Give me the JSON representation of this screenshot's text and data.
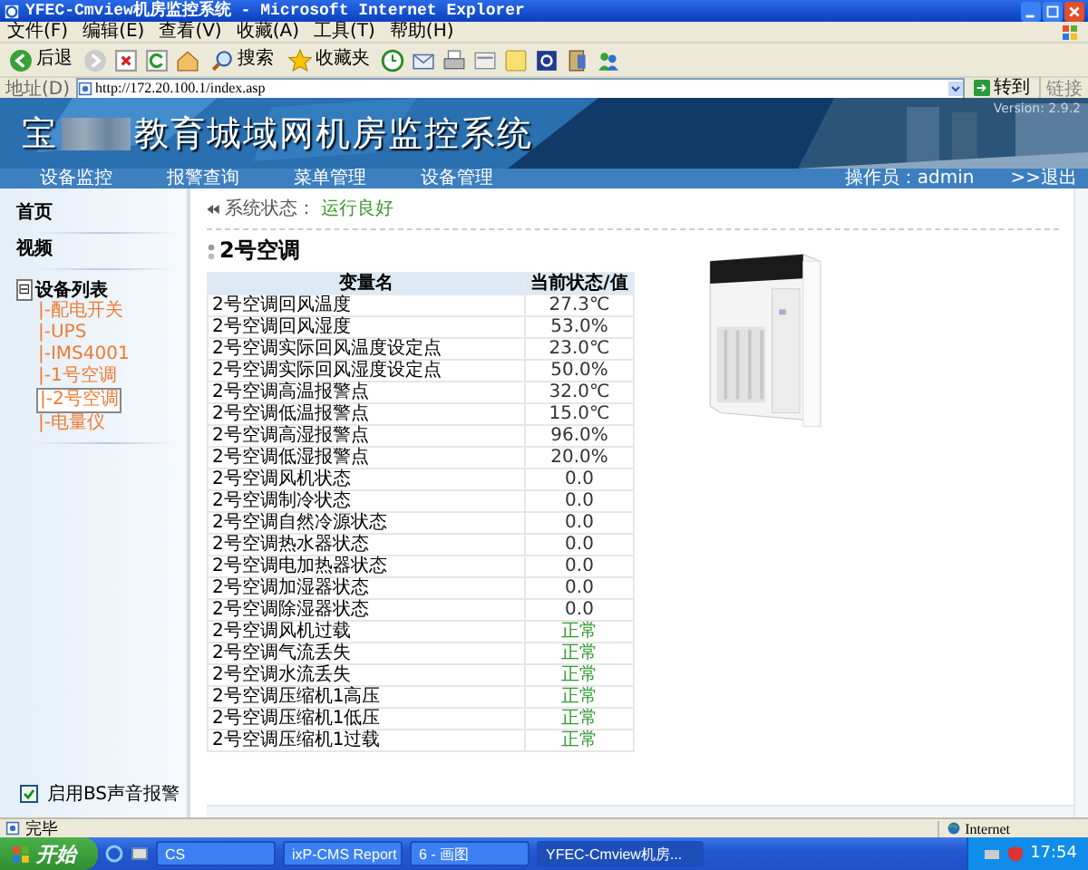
{
  "window": {
    "title": "YFEC-Cmview机房监控系统 - Microsoft Internet Explorer"
  },
  "menu": [
    "文件(F)",
    "编辑(E)",
    "查看(V)",
    "收藏(A)",
    "工具(T)",
    "帮助(H)"
  ],
  "toolbar": {
    "back": "后退",
    "search": "搜索",
    "favorites": "收藏夹"
  },
  "address": {
    "label": "地址(D)",
    "value": "http://172.20.100.1/index.asp",
    "go": "转到",
    "links": "链接"
  },
  "banner": {
    "title_start": "宝",
    "title_end": "教育城域网机房监控系统",
    "version": "Version: 2.9.2"
  },
  "nav": {
    "items": [
      {
        "label": "设备监控"
      },
      {
        "label": "报警查询"
      },
      {
        "label": "菜单管理"
      },
      {
        "label": "设备管理"
      }
    ],
    "operator": "操作员：admin",
    "logout": ">>退出"
  },
  "sidebar": {
    "items": [
      {
        "label": "首页"
      },
      {
        "label": "视频"
      }
    ],
    "tree": {
      "label": "设备列表",
      "expanded": true,
      "toggle": "⊟",
      "children": [
        {
          "label": "|-配电开关",
          "selected": false
        },
        {
          "label": "|-UPS",
          "selected": false
        },
        {
          "label": "|-IMS4001",
          "selected": false
        },
        {
          "label": "|-1号空调",
          "selected": false
        },
        {
          "label": "|-2号空调",
          "selected": true
        },
        {
          "label": "|-电量仪",
          "selected": false
        }
      ]
    },
    "sound_alarm": {
      "label": "启用BS声音报警",
      "checked": true
    }
  },
  "status_line": {
    "label": "系统状态：",
    "value": "运行良好"
  },
  "device_title": "2号空调",
  "table": {
    "columns": [
      "变量名",
      "当前状态/值"
    ],
    "rows": [
      {
        "name": "2号空调回风温度",
        "value": "27.3℃",
        "kind": "value"
      },
      {
        "name": "2号空调回风湿度",
        "value": "53.0%",
        "kind": "value"
      },
      {
        "name": "2号空调实际回风温度设定点",
        "value": "23.0℃",
        "kind": "value"
      },
      {
        "name": "2号空调实际回风湿度设定点",
        "value": "50.0%",
        "kind": "value"
      },
      {
        "name": "2号空调高温报警点",
        "value": "32.0℃",
        "kind": "value"
      },
      {
        "name": "2号空调低温报警点",
        "value": "15.0℃",
        "kind": "value"
      },
      {
        "name": "2号空调高湿报警点",
        "value": "96.0%",
        "kind": "value"
      },
      {
        "name": "2号空调低湿报警点",
        "value": "20.0%",
        "kind": "value"
      },
      {
        "name": "2号空调风机状态",
        "value": "0.0",
        "kind": "value"
      },
      {
        "name": "2号空调制冷状态",
        "value": "0.0",
        "kind": "value"
      },
      {
        "name": "2号空调自然冷源状态",
        "value": "0.0",
        "kind": "value"
      },
      {
        "name": "2号空调热水器状态",
        "value": "0.0",
        "kind": "value"
      },
      {
        "name": "2号空调电加热器状态",
        "value": "0.0",
        "kind": "value"
      },
      {
        "name": "2号空调加湿器状态",
        "value": "0.0",
        "kind": "value"
      },
      {
        "name": "2号空调除湿器状态",
        "value": "0.0",
        "kind": "value"
      },
      {
        "name": "2号空调风机过载",
        "value": "正常",
        "kind": "status"
      },
      {
        "name": "2号空调气流丢失",
        "value": "正常",
        "kind": "status"
      },
      {
        "name": "2号空调水流丢失",
        "value": "正常",
        "kind": "status"
      },
      {
        "name": "2号空调压缩机1高压",
        "value": "正常",
        "kind": "status"
      },
      {
        "name": "2号空调压缩机1低压",
        "value": "正常",
        "kind": "status"
      },
      {
        "name": "2号空调压缩机1过载",
        "value": "正常",
        "kind": "status"
      }
    ]
  },
  "status_bar": {
    "text": "完毕",
    "zone": "Internet"
  },
  "taskbar": {
    "start": "开始",
    "tasks": [
      {
        "label": "CS",
        "selected": false
      },
      {
        "label": "ixP-CMS Report",
        "selected": false
      },
      {
        "label": "6 - 画图",
        "selected": false
      },
      {
        "label": "YFEC-Cmview机房...",
        "selected": true
      }
    ],
    "clock": "17:54"
  }
}
